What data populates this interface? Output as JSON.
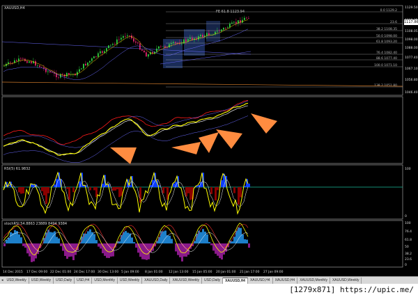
{
  "chart": {
    "symbol_title": "XAUUSD,H4",
    "indicator_1_title": "",
    "indicator_2_title": "RSI(5) 61.9832",
    "indicator_3_title": "stochRSI 54.8863 23889 8494 9384",
    "current_price": "1117.86",
    "price_axis": [
      "1129.50",
      "1118.35",
      "1108.05",
      "1098.00",
      "1088.00",
      "1077.40",
      "1067.10",
      "1056.80",
      "1046.40"
    ],
    "rsi_axis": [
      "100",
      "0"
    ],
    "stoch_axis": [
      "100",
      "76.4",
      "61.8",
      "50",
      "38.2",
      "23.6",
      "0"
    ],
    "fib_levels": [
      "0.0 1129.2",
      "23.6",
      "38.2 1108.35",
      "50.0 1098.00",
      "61.8 1093.20",
      "76.4 1082.40",
      "88.6 1077.40",
      "100.0 1071.10",
      "138.2 1051.80"
    ],
    "fib_top_label": "FE 61.8 1123.94",
    "time_axis": [
      "14 Dec 2015",
      "17 Dec 09:00",
      "22 Dec 01:00",
      "24 Dec 17:00",
      "30 Dec 13:00",
      "5 Jan 09:00",
      "8 Jan 01:00",
      "12 Jan 13:00",
      "15 Jan 05:00",
      "20 Jan 01:00",
      "21 Jan 17:00",
      "27 Jan 09:00"
    ],
    "colors": {
      "bull": "#2ecc40",
      "bear": "#e0246c",
      "ma_fast": "#ffff00",
      "ma_slow": "#ff1a1a",
      "bands": "#6a6aff",
      "fib": "#c0c0c0",
      "rsi_fill": "#0a3cff",
      "rsi_neg": "#8b0000",
      "stoch_pos": "#1d7fc9",
      "stoch_neg": "#8a1a8a",
      "arrow": "#ff8c40"
    }
  },
  "tabs": [
    "USD,Weekly",
    "USD,Weekly",
    "USD,Daily",
    "USD,H4",
    "USD,Monthly",
    "USD,Weekly",
    "XAUUSD,Daily",
    "XAUUSD,Weekly",
    "USD,Daily",
    "XAUUSD,H4",
    "XAUUSD,H4",
    "XAUUSD,H4",
    "XAUUSD,Monthly",
    "XAUUSD,Weekly"
  ],
  "active_tab_index": 9,
  "footer": {
    "watermark": "[1279x871] https://upic.me/"
  }
}
